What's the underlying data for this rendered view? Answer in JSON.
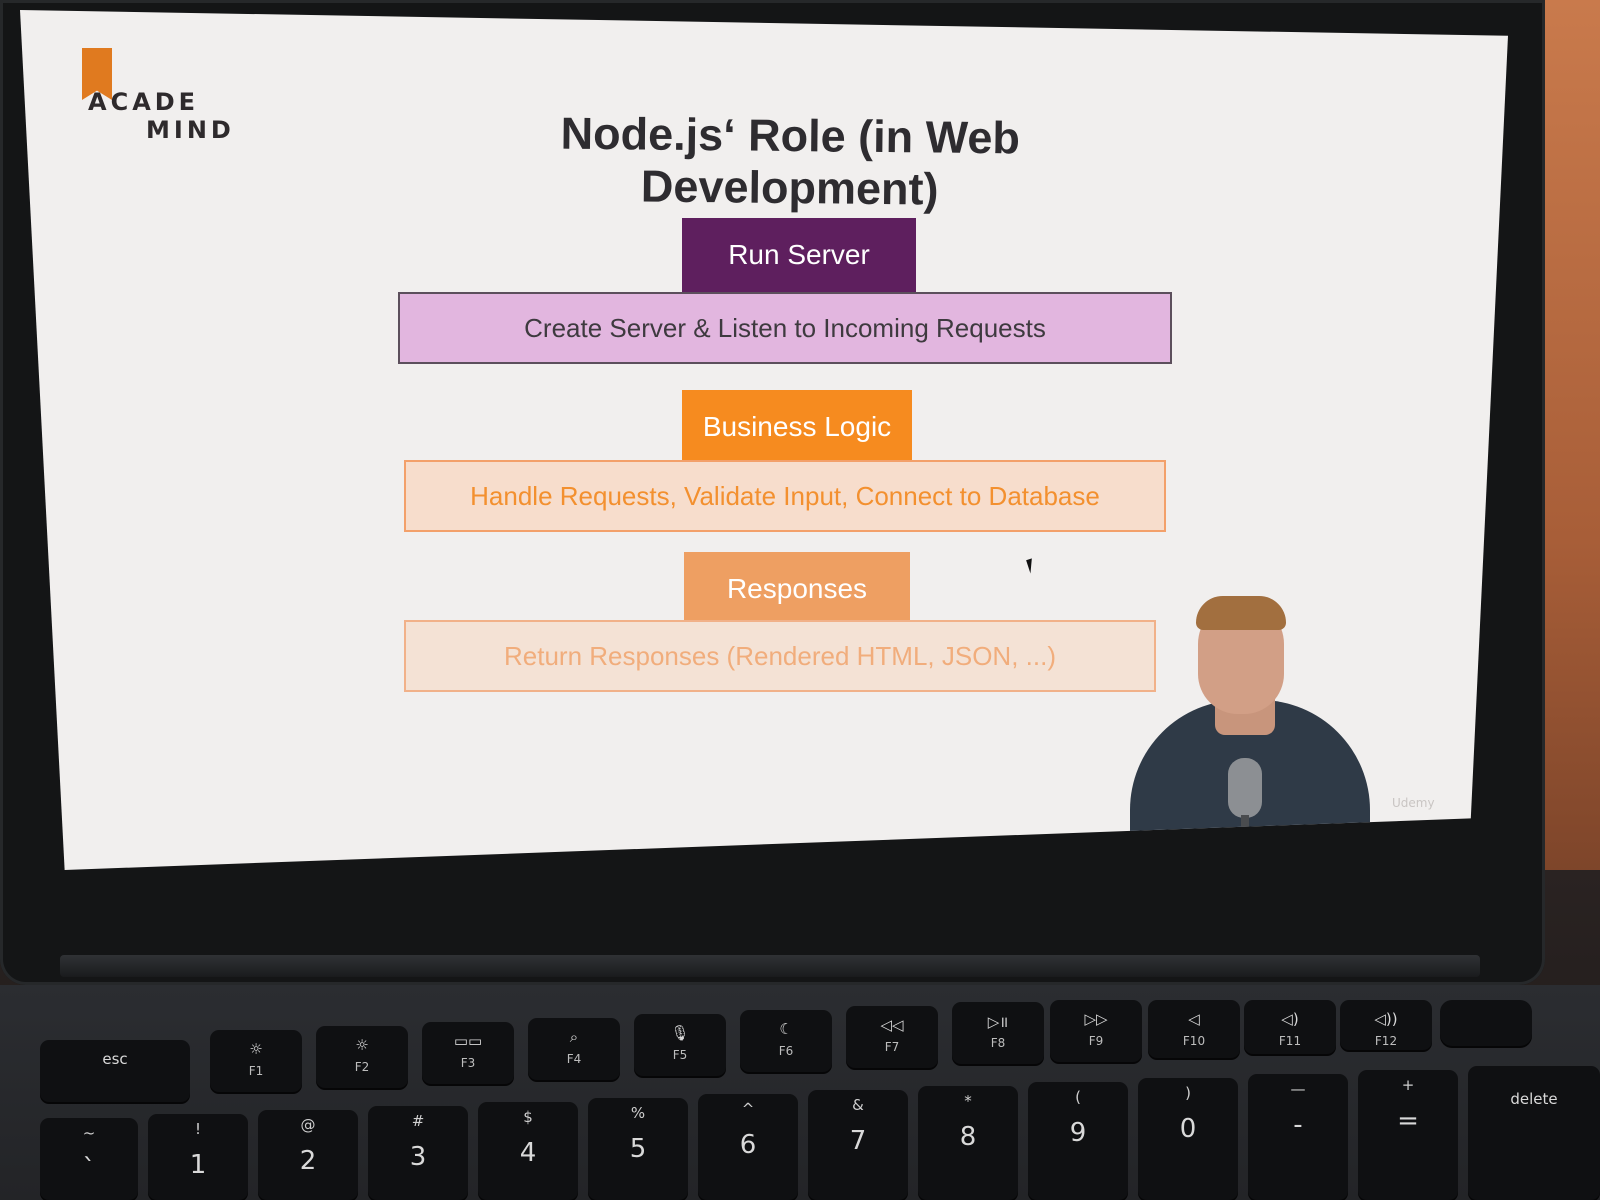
{
  "logo": {
    "line1": "ACADE",
    "line2": "MIND"
  },
  "slide": {
    "title": "Node.js‘ Role (in Web Development)",
    "sections": [
      {
        "tab": "Run Server",
        "description": "Create Server & Listen to Incoming Requests",
        "tab_color": "#5e1f5e",
        "band_color": "#e2b6df"
      },
      {
        "tab": "Business Logic",
        "description": "Handle Requests, Validate Input, Connect to Database",
        "tab_color": "#f68b1f",
        "band_color": "#f7ddcc"
      },
      {
        "tab": "Responses",
        "description": "Return Responses (Rendered HTML, JSON, ...)",
        "tab_color": "#ee9f62",
        "band_color": "#f4e2d5"
      }
    ]
  },
  "video": {
    "watermark": "Udemy"
  },
  "keyboard": {
    "function_row": [
      {
        "main": "esc",
        "sub": ""
      },
      {
        "main": "☼",
        "sub": "F1"
      },
      {
        "main": "☼",
        "sub": "F2"
      },
      {
        "main": "▭▭",
        "sub": "F3"
      },
      {
        "main": "⌕",
        "sub": "F4"
      },
      {
        "main": "🎙",
        "sub": "F5"
      },
      {
        "main": "☾",
        "sub": "F6"
      },
      {
        "main": "◁◁",
        "sub": "F7"
      },
      {
        "main": "▷॥",
        "sub": "F8"
      },
      {
        "main": "▷▷",
        "sub": "F9"
      },
      {
        "main": "◁",
        "sub": "F10"
      },
      {
        "main": "◁)",
        "sub": "F11"
      },
      {
        "main": "◁))",
        "sub": "F12"
      }
    ],
    "number_row": [
      {
        "sym": "~",
        "main": "`"
      },
      {
        "sym": "!",
        "main": "1"
      },
      {
        "sym": "@",
        "main": "2"
      },
      {
        "sym": "#",
        "main": "3"
      },
      {
        "sym": "$",
        "main": "4"
      },
      {
        "sym": "%",
        "main": "5"
      },
      {
        "sym": "^",
        "main": "6"
      },
      {
        "sym": "&",
        "main": "7"
      },
      {
        "sym": "*",
        "main": "8"
      },
      {
        "sym": "(",
        "main": "9"
      },
      {
        "sym": ")",
        "main": "0"
      },
      {
        "sym": "—",
        "main": "-"
      },
      {
        "sym": "+",
        "main": "="
      },
      {
        "sym": "",
        "main": "delete"
      }
    ]
  }
}
